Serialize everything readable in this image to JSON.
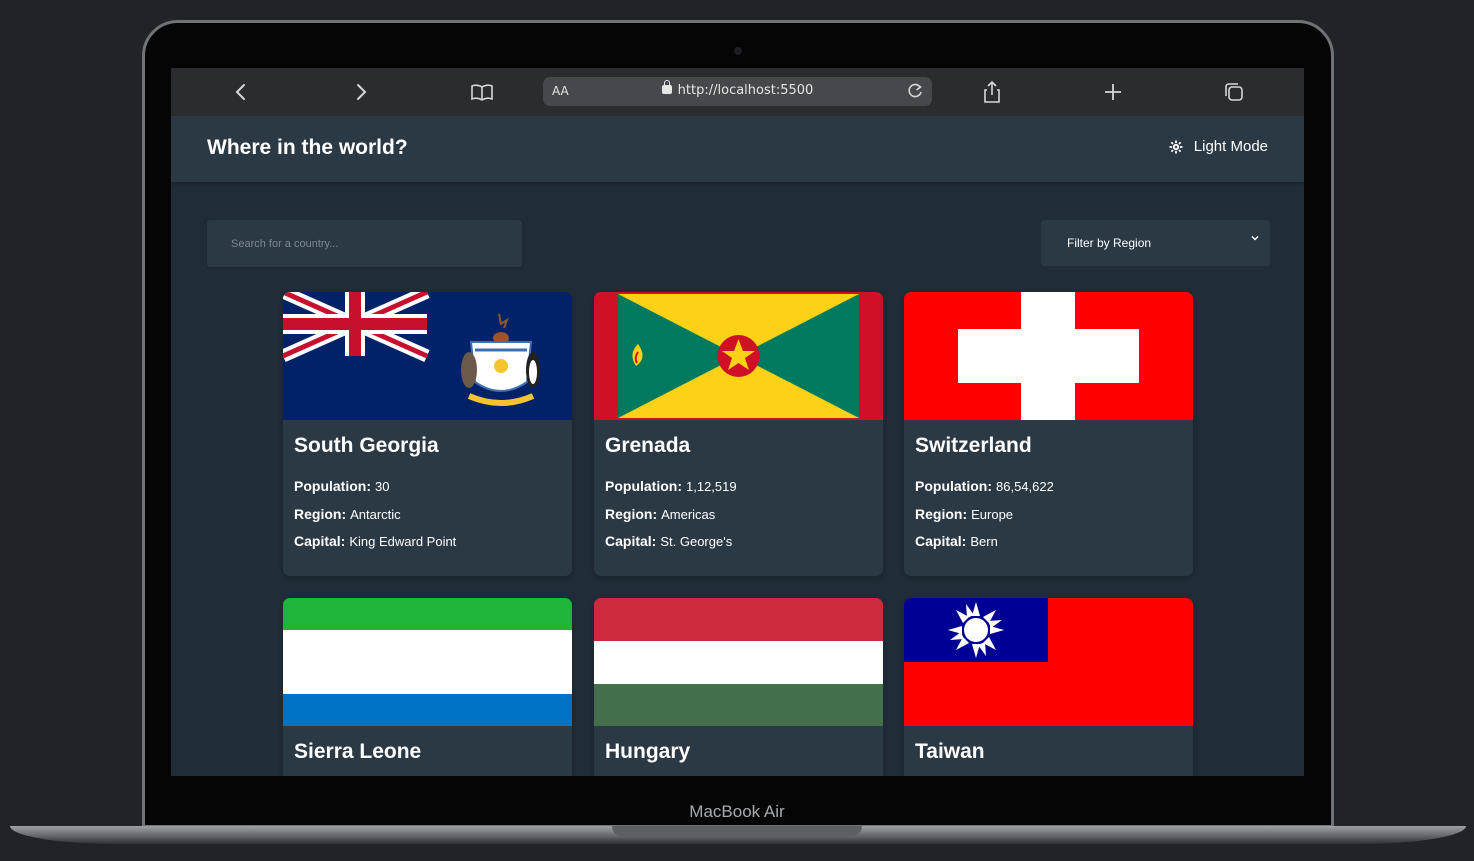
{
  "device": {
    "label": "MacBook Air"
  },
  "browser": {
    "address_prefix": "AA",
    "url": "http://localhost:5500",
    "icons": [
      "back-icon",
      "forward-icon",
      "bookmarks-icon",
      "lock-icon",
      "reload-icon",
      "share-icon",
      "new-tab-icon",
      "tabs-icon"
    ]
  },
  "header": {
    "title": "Where in the world?",
    "mode_toggle": "Light Mode"
  },
  "search": {
    "placeholder": "Search for a country..."
  },
  "filter": {
    "label": "Filter by Region"
  },
  "labels": {
    "population": "Population:",
    "region": "Region:",
    "capital": "Capital:"
  },
  "countries": [
    {
      "name": "South Georgia",
      "population": "30",
      "region": "Antarctic",
      "capital": "King Edward Point"
    },
    {
      "name": "Grenada",
      "population": "1,12,519",
      "region": "Americas",
      "capital": "St. George's"
    },
    {
      "name": "Switzerland",
      "population": "86,54,622",
      "region": "Europe",
      "capital": "Bern"
    },
    {
      "name": "Sierra Leone"
    },
    {
      "name": "Hungary"
    },
    {
      "name": "Taiwan"
    }
  ],
  "colors": {
    "background": "#202c37",
    "element": "#2b3945",
    "text": "#ffffff"
  }
}
